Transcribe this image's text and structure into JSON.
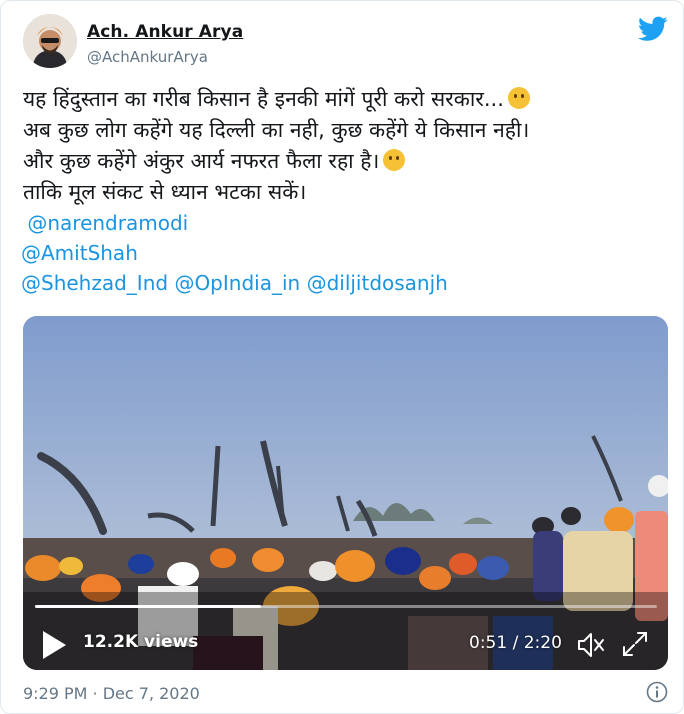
{
  "author": {
    "display_name": "Ach. Ankur Arya",
    "handle": "@AchAnkurArya"
  },
  "tweet": {
    "lines": [
      "यह हिंदुस्तान का गरीब किसान है इनकी मांगें पूरी करो सरकार...",
      "अब कुछ लोग कहेंगे यह दिल्ली का नही, कुछ कहेंगे ये किसान नही।",
      "और कुछ कहेंगे अंकुर आर्य नफरत फैला रहा है।",
      "ताकि मूल संकट से ध्यान भटका सकें।"
    ],
    "emojis": [
      "confused-face",
      "face-with-rolling-eyes"
    ],
    "mentions": {
      "narendramodi": "@narendramodi",
      "amitshah": "@AmitShah",
      "shehzad": "@Shehzad_Ind",
      "opindia": "@OpIndia_in",
      "diljit": "@diljitdosanjh"
    }
  },
  "video": {
    "views": "12.2K views",
    "time": "0:51 / 2:20",
    "progress_fraction": 0.364
  },
  "meta": {
    "timestamp": "9:29 PM · Dec 7, 2020"
  },
  "icons": {
    "brand": "twitter-bird-icon",
    "play": "play-icon",
    "mute": "mute-icon",
    "fullscreen": "fullscreen-icon",
    "info": "info-icon"
  },
  "colors": {
    "link": "#1b95e0",
    "twitter_blue": "#1da1f2",
    "muted_text": "#657786"
  }
}
